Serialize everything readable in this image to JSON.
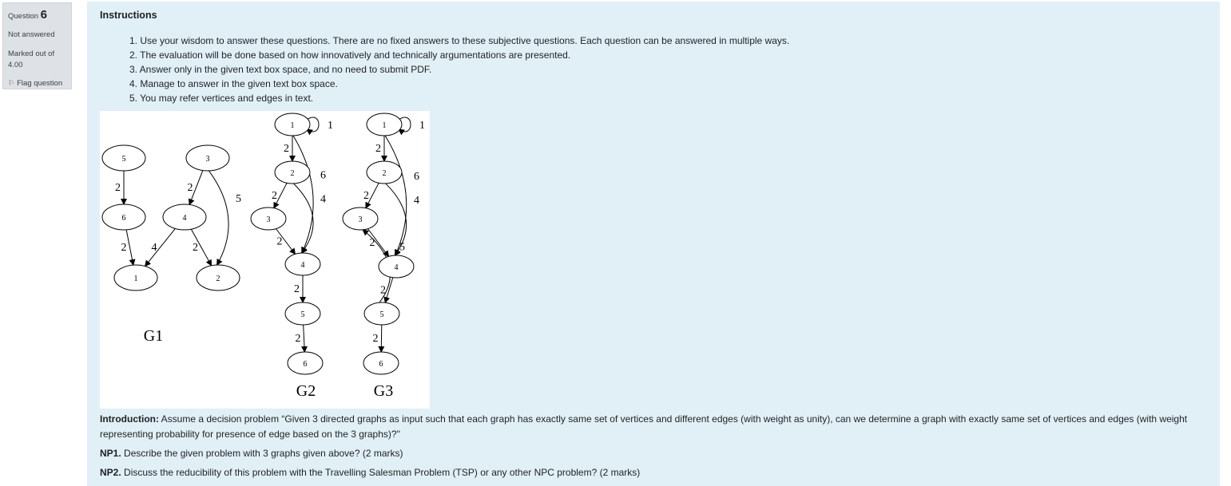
{
  "question_info": {
    "question_label": "Question",
    "question_number": "6",
    "state": "Not answered",
    "grade": "Marked out of 4.00",
    "flag_label": "Flag question",
    "flag_icon": "flag-icon"
  },
  "instructions": {
    "title": "Instructions",
    "items": [
      "1. Use your wisdom to answer these questions. There are no fixed answers to these subjective questions. Each question can be answered in multiple ways.",
      "2. The evaluation will be done based on how innovatively and technically argumentations are presented.",
      "3. Answer only in the given text box space, and no need to submit PDF.",
      "4. Manage to answer in the given text box space.",
      "5. You may refer vertices and edges in text."
    ]
  },
  "figure": {
    "graphs": [
      {
        "label": "G1",
        "nodes": [
          "5",
          "3",
          "6",
          "4",
          "1",
          "2"
        ],
        "edges": [
          {
            "from": "5",
            "to": "6",
            "weight": "2"
          },
          {
            "from": "3",
            "to": "4",
            "weight": "2"
          },
          {
            "from": "3",
            "to": "2",
            "weight": "5"
          },
          {
            "from": "6",
            "to": "1",
            "weight": "2"
          },
          {
            "from": "4",
            "to": "1",
            "weight": "4"
          },
          {
            "from": "4",
            "to": "2",
            "weight": "2"
          }
        ]
      },
      {
        "label": "G2",
        "nodes": [
          "1",
          "2",
          "3",
          "4",
          "5",
          "6"
        ],
        "edges": [
          {
            "from": "1",
            "to": "1",
            "weight": "1"
          },
          {
            "from": "1",
            "to": "2",
            "weight": "2"
          },
          {
            "from": "1",
            "to": "4",
            "weight": "6"
          },
          {
            "from": "2",
            "to": "3",
            "weight": "2"
          },
          {
            "from": "2",
            "to": "4",
            "weight": "4"
          },
          {
            "from": "3",
            "to": "4",
            "weight": "2"
          },
          {
            "from": "4",
            "to": "5",
            "weight": "2"
          },
          {
            "from": "5",
            "to": "6",
            "weight": "2"
          }
        ]
      },
      {
        "label": "G3",
        "nodes": [
          "1",
          "2",
          "3",
          "4",
          "5",
          "6"
        ],
        "edges": [
          {
            "from": "1",
            "to": "1",
            "weight": "1"
          },
          {
            "from": "1",
            "to": "2",
            "weight": "2"
          },
          {
            "from": "1",
            "to": "4",
            "weight": "6"
          },
          {
            "from": "2",
            "to": "3",
            "weight": "2"
          },
          {
            "from": "2",
            "to": "4",
            "weight": "4"
          },
          {
            "from": "3",
            "to": "4",
            "weight": "2"
          },
          {
            "from": "5",
            "to": "3",
            "weight": "5"
          },
          {
            "from": "4",
            "to": "5",
            "weight": "2"
          },
          {
            "from": "5",
            "to": "6",
            "weight": "2"
          }
        ]
      }
    ]
  },
  "introduction": {
    "label": "Introduction:",
    "text": " Assume a decision problem “Given 3 directed graphs as input such that each graph has exactly same set of vertices and different edges (with weight as unity), can we determine a graph with exactly same set of vertices and edges (with weight representing probability for presence of edge based on the 3 graphs)?\""
  },
  "np1": {
    "label": "NP1.",
    "text": " Describe the given problem with 3 graphs given above? (2 marks)"
  },
  "np2": {
    "label": "NP2.",
    "text": " Discuss the reducibility of this problem with the Travelling Salesman Problem (TSP) or any other NPC problem? (2 marks)"
  }
}
